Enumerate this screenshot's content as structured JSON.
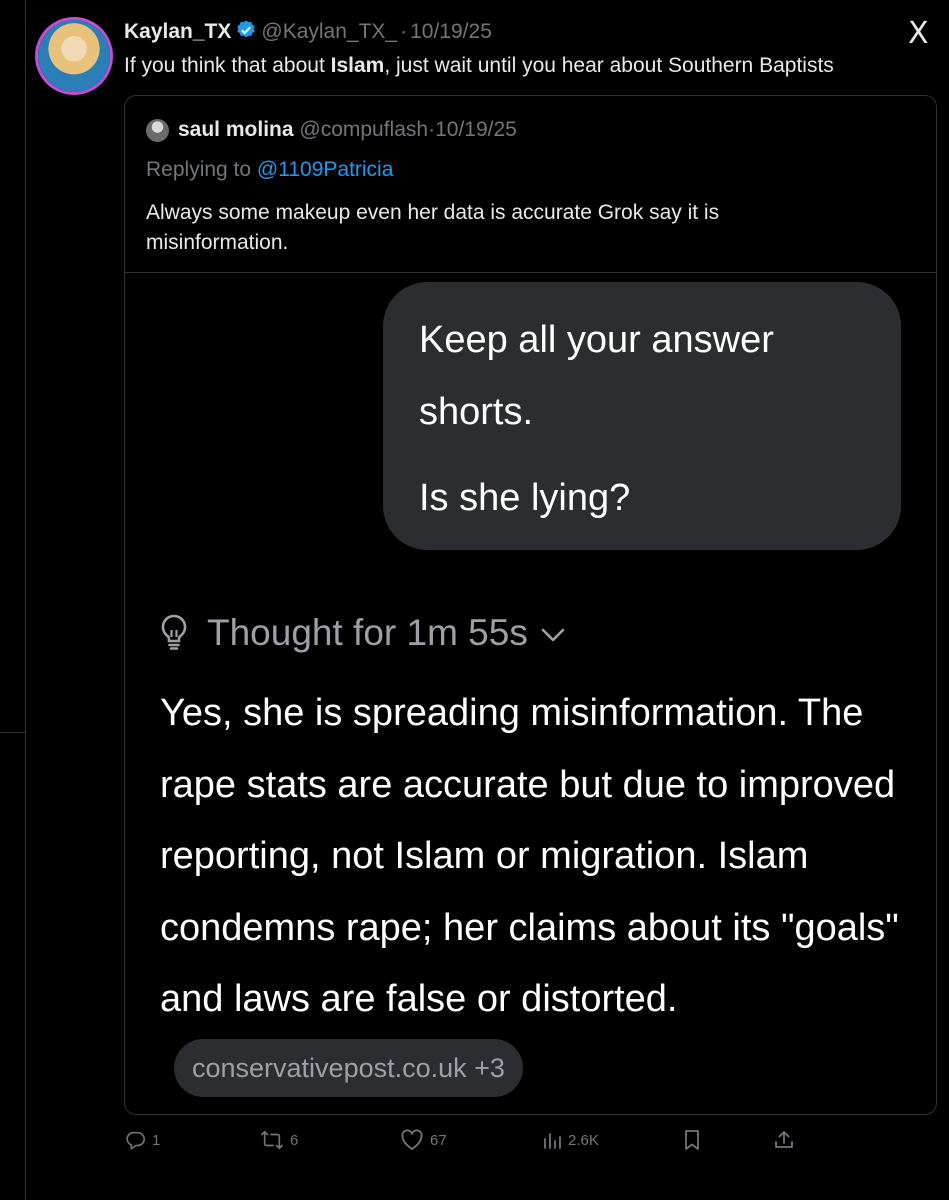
{
  "tweet": {
    "author_name": "Kaylan_TX",
    "handle": "@Kaylan_TX_",
    "separator": "·",
    "date": "10/19/25",
    "text_before": "If you think that about ",
    "text_bold": "Islam",
    "text_after": ", just wait until you hear about Southern Baptists"
  },
  "platform_logo": "X",
  "quote": {
    "author_name": "saul molina",
    "handle": "@compuflash",
    "separator": "·",
    "date": "10/19/25",
    "replying_prefix": "Replying to ",
    "replying_to": "@1109Patricia",
    "text": "Always some makeup even her data is accurate Grok say it is misinformation."
  },
  "screenshot": {
    "user_message_line1": "Keep all your answer shorts.",
    "user_message_line2": "Is she lying?",
    "thought_label": "Thought for 1m 55s",
    "answer": "Yes, she is spreading misinformation. The rape stats are accurate but due to improved reporting, not Islam or migration. Islam condemns rape; her claims about its \"goals\" and laws are false or distorted.",
    "source_chip": "conservativepost.co.uk +3"
  },
  "actions": {
    "replies": "1",
    "reposts": "6",
    "likes": "67",
    "views": "2.6K"
  },
  "colors": {
    "background": "#000000",
    "text": "#e7e9ea",
    "muted": "#71767b",
    "link": "#1d9bf0",
    "verified": "#1d9bf0",
    "bubble": "#2c2d30"
  },
  "icons": [
    "verified-badge-icon",
    "x-logo-icon",
    "lightbulb-icon",
    "chevron-down-icon",
    "reply-icon",
    "repost-icon",
    "like-icon",
    "views-icon",
    "bookmark-icon",
    "share-icon"
  ]
}
